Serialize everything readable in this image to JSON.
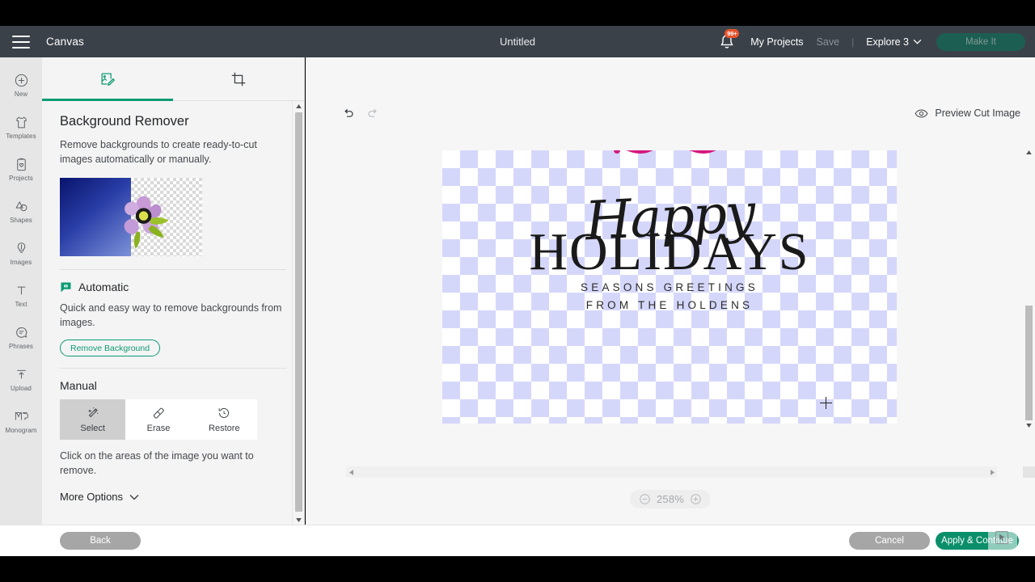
{
  "header": {
    "menu_icon": "hamburger-icon",
    "app_label": "Canvas",
    "document_title": "Untitled",
    "notifications_icon": "bell-icon",
    "notifications_badge": "99+",
    "my_projects_label": "My Projects",
    "save_label": "Save",
    "divider": "|",
    "explore_label": "Explore 3",
    "explore_caret_icon": "chevron-down-icon",
    "make_it_label": "Make It",
    "bg_color": "#3b4149",
    "badge_color": "#e8532d",
    "make_it_color": "#1d5e52"
  },
  "sidebar": {
    "items": [
      {
        "label": "New",
        "icon": "plus-circle-icon"
      },
      {
        "label": "Templates",
        "icon": "shirt-icon"
      },
      {
        "label": "Projects",
        "icon": "clipboard-heart-icon"
      },
      {
        "label": "Shapes",
        "icon": "shapes-icon"
      },
      {
        "label": "Images",
        "icon": "lightbulb-icon"
      },
      {
        "label": "Text",
        "icon": "text-t-icon"
      },
      {
        "label": "Phrases",
        "icon": "speech-bubble-icon"
      },
      {
        "label": "Upload",
        "icon": "upload-arrow-icon"
      },
      {
        "label": "Monogram",
        "icon": "monogram-icon"
      }
    ]
  },
  "panel": {
    "tabs": [
      {
        "name": "edit-image",
        "icon": "image-edit-icon",
        "active": true
      },
      {
        "name": "crop",
        "icon": "crop-icon",
        "active": false
      }
    ],
    "title": "Background Remover",
    "description": "Remove backgrounds to create ready-to-cut images automatically or manually.",
    "preview_image_alt": "flower-before-after-thumbnail",
    "automatic": {
      "icon": "automatic-wand-icon",
      "title": "Automatic",
      "description": "Quick and easy way to remove backgrounds from images.",
      "button_label": "Remove Background",
      "accent_color": "#0d9b74"
    },
    "manual": {
      "title": "Manual",
      "tools": [
        {
          "label": "Select",
          "icon": "magic-wand-icon",
          "selected": true
        },
        {
          "label": "Erase",
          "icon": "eraser-icon",
          "selected": false
        },
        {
          "label": "Restore",
          "icon": "restore-clock-icon",
          "selected": false
        }
      ],
      "hint": "Click on the areas of the image you want to remove."
    },
    "more_options_label": "More Options",
    "more_options_icon": "chevron-down-icon"
  },
  "workspace": {
    "undo_icon": "undo-arrow-icon",
    "redo_icon": "redo-arrow-icon",
    "preview_cut_icon": "eye-icon",
    "preview_cut_label": "Preview Cut Image",
    "zoom": {
      "minus_icon": "minus-circle-icon",
      "value": "258%",
      "plus_icon": "plus-circle-icon"
    },
    "artwork": {
      "script_line": "Happy",
      "headline": "HOLIDAYS",
      "sub_line_1": "SEASONS GREETINGS",
      "sub_line_2": "FROM THE HOLDENS",
      "accent_shape_color": "#d6197e",
      "checker_color": "#d5d7fa"
    },
    "cursor_icon": "crosshair-cursor"
  },
  "bottom": {
    "back_label": "Back",
    "cancel_label": "Cancel",
    "apply_label": "Apply & Continue",
    "apply_color": "#0b8f6b",
    "muted_color": "#a6a6a6",
    "overlay_icon": "cursor-pointer-icon"
  }
}
